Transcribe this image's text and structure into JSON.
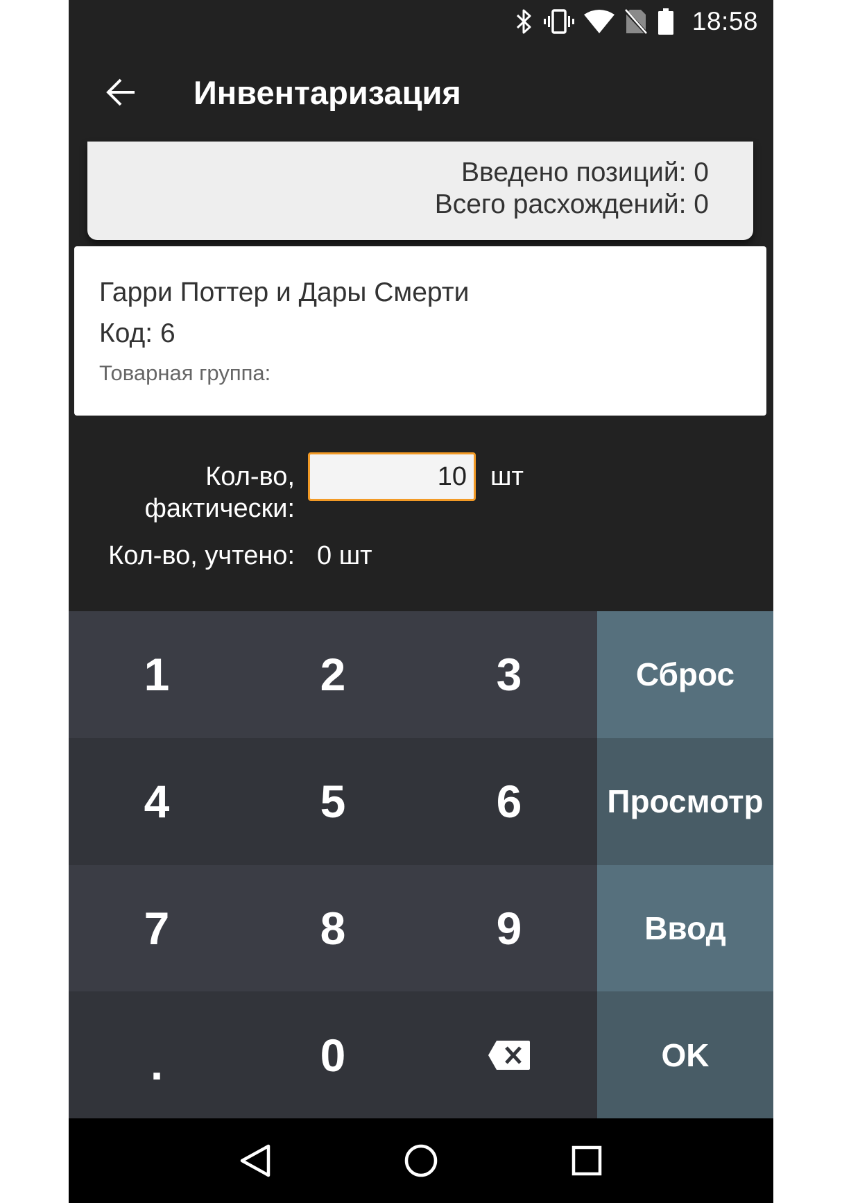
{
  "status_bar": {
    "time": "18:58",
    "icons": [
      "bluetooth-icon",
      "vibrate-icon",
      "wifi-icon",
      "no-sim-icon",
      "battery-icon"
    ]
  },
  "app_bar": {
    "title": "Инвентаризация",
    "back_icon": "arrow-left-icon"
  },
  "summary": {
    "positions_entered": "Введено позиций: 0",
    "total_discrepancies": "Всего расхождений: 0"
  },
  "product": {
    "name": "Гарри Поттер и Дары Смерти",
    "code": "Код: 6",
    "group": "Товарная группа:"
  },
  "quantity": {
    "actual_label_line1": "Кол-во,",
    "actual_label_line2": "фактически:",
    "actual_value": "10",
    "unit": "шт",
    "counted_label": "Кол-во, учтено:",
    "counted_value": "0 шт"
  },
  "keypad": {
    "k1": "1",
    "k2": "2",
    "k3": "3",
    "reset": "Сброс",
    "k4": "4",
    "k5": "5",
    "k6": "6",
    "view": "Просмотр",
    "k7": "7",
    "k8": "8",
    "k9": "9",
    "enter": "Ввод",
    "dot": ".",
    "k0": "0",
    "backspace_icon": "backspace-icon",
    "ok": "OK"
  },
  "colors": {
    "background": "#222222",
    "input_border": "#f29a26",
    "digit_key": "#3b3d45",
    "action_key": "#56707d",
    "nav_bar": "#000000"
  },
  "nav_bar": {
    "icons": [
      "nav-back-icon",
      "nav-home-icon",
      "nav-recents-icon"
    ]
  }
}
